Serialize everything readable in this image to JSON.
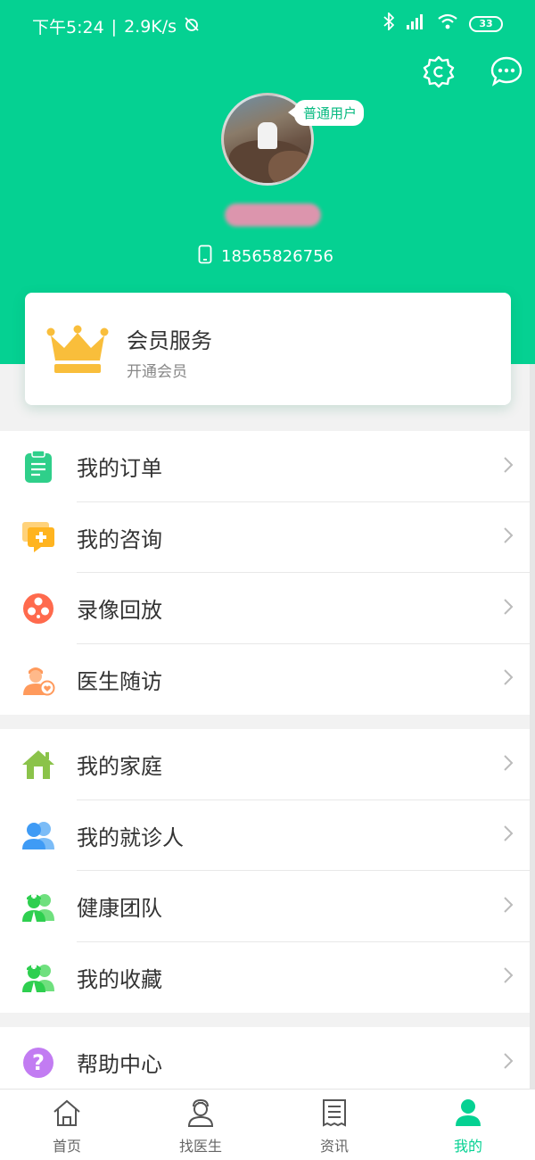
{
  "status_bar": {
    "time": "下午5:24",
    "speed": "2.9K/s",
    "battery": "33"
  },
  "profile": {
    "badge": "普通用户",
    "phone": "18565826756"
  },
  "member": {
    "title": "会员服务",
    "subtitle": "开通会员"
  },
  "group1": [
    {
      "label": "我的订单",
      "icon": "order-icon",
      "color": "#2fcf8a"
    },
    {
      "label": "我的咨询",
      "icon": "consult-icon",
      "color": "#ffb420"
    },
    {
      "label": "录像回放",
      "icon": "video-icon",
      "color": "#ff6a4d"
    },
    {
      "label": "医生随访",
      "icon": "doctor-visit-icon",
      "color": "#ff9a5c"
    }
  ],
  "group2": [
    {
      "label": "我的家庭",
      "icon": "home-icon",
      "color": "#8bc34a"
    },
    {
      "label": "我的就诊人",
      "icon": "patients-icon",
      "color": "#3f9bf5"
    },
    {
      "label": "健康团队",
      "icon": "health-team-icon",
      "color": "#2ecf4f"
    },
    {
      "label": "我的收藏",
      "icon": "favorites-icon",
      "color": "#2ecf4f"
    }
  ],
  "group3": [
    {
      "label": "帮助中心",
      "icon": "help-icon",
      "color": "#c27cf2"
    }
  ],
  "tabs": [
    {
      "label": "首页",
      "icon": "home-tab-icon"
    },
    {
      "label": "找医生",
      "icon": "find-doctor-icon"
    },
    {
      "label": "资讯",
      "icon": "news-icon"
    },
    {
      "label": "我的",
      "icon": "me-icon",
      "active": true
    }
  ],
  "colors": {
    "brand": "#05d192",
    "crown": "#f9be3b"
  }
}
